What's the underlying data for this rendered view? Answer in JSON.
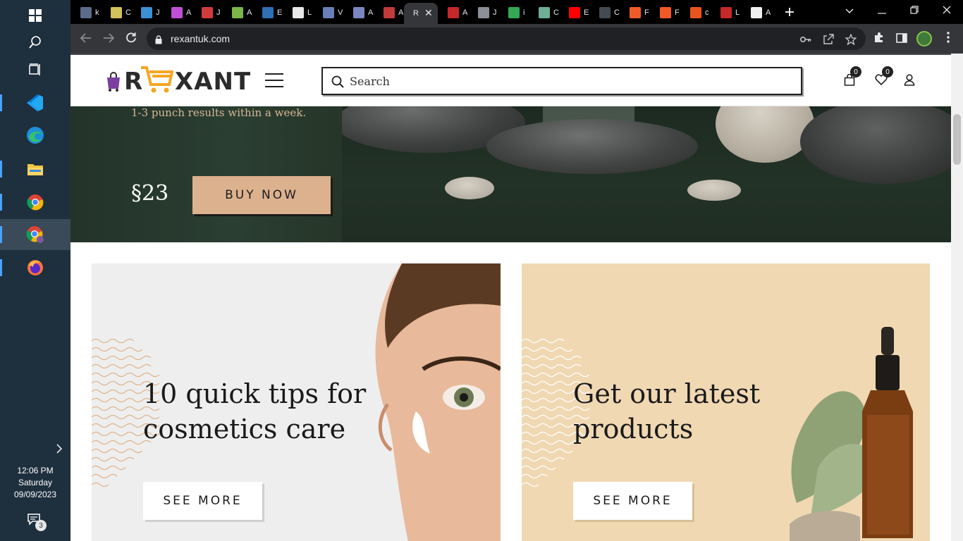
{
  "taskbar": {
    "clock_time": "12:06 PM",
    "clock_day": "Saturday",
    "clock_date": "09/09/2023",
    "notification_count": "3",
    "apps": [
      "start",
      "search",
      "task-view",
      "vscode",
      "edge",
      "file-explorer",
      "chrome",
      "chrome-profile",
      "firefox"
    ]
  },
  "browser": {
    "tabs": [
      {
        "title": "k",
        "fav_color": "#5b6b8a"
      },
      {
        "title": "C",
        "fav_color": "#d4c25a"
      },
      {
        "title": "J",
        "fav_color": "#3d8fd1"
      },
      {
        "title": "A",
        "fav_color": "#c04fd8"
      },
      {
        "title": "J",
        "fav_color": "#d23b3b"
      },
      {
        "title": "A",
        "fav_color": "#7ab648"
      },
      {
        "title": "E",
        "fav_color": "#2f6fb5"
      },
      {
        "title": "L",
        "fav_color": "#e8e8e8"
      },
      {
        "title": "V",
        "fav_color": "#6a7fb8"
      },
      {
        "title": "A",
        "fav_color": "#7a86c0"
      },
      {
        "title": "A",
        "fav_color": "#c23a3a"
      },
      {
        "title": "R",
        "fav_color": "#35363a",
        "active": true
      },
      {
        "title": "A",
        "fav_color": "#c62828"
      },
      {
        "title": "J",
        "fav_color": "#8a8f98"
      },
      {
        "title": "i",
        "fav_color": "#34a853"
      },
      {
        "title": "C",
        "fav_color": "#6fae96"
      },
      {
        "title": "E",
        "fav_color": "#ff0000"
      },
      {
        "title": "C",
        "fav_color": "#444a52"
      },
      {
        "title": "F",
        "fav_color": "#f05a28"
      },
      {
        "title": "F",
        "fav_color": "#f05a28"
      },
      {
        "title": "c",
        "fav_color": "#e8541c"
      },
      {
        "title": "L",
        "fav_color": "#c62828"
      },
      {
        "title": "A",
        "fav_color": "#f0f0f0"
      }
    ],
    "url": "rexantuk.com"
  },
  "site": {
    "logo_r": "R",
    "logo_text": "XANT",
    "search_placeholder": "Search",
    "cart_count": "0",
    "wishlist_count": "0"
  },
  "hero": {
    "subtitle": "1-3 punch results within a week.",
    "price": "§23",
    "button_label": "BUY NOW"
  },
  "cards": [
    {
      "title": "10 quick tips for cosmetics care",
      "button_label": "SEE MORE"
    },
    {
      "title": "Get our latest products",
      "button_label": "SEE MORE"
    }
  ],
  "colors": {
    "accent_tan": "#dcb18e",
    "hero_green": "#24342a",
    "card_beige": "#f0d8b3",
    "card_grey": "#eeeeee"
  }
}
